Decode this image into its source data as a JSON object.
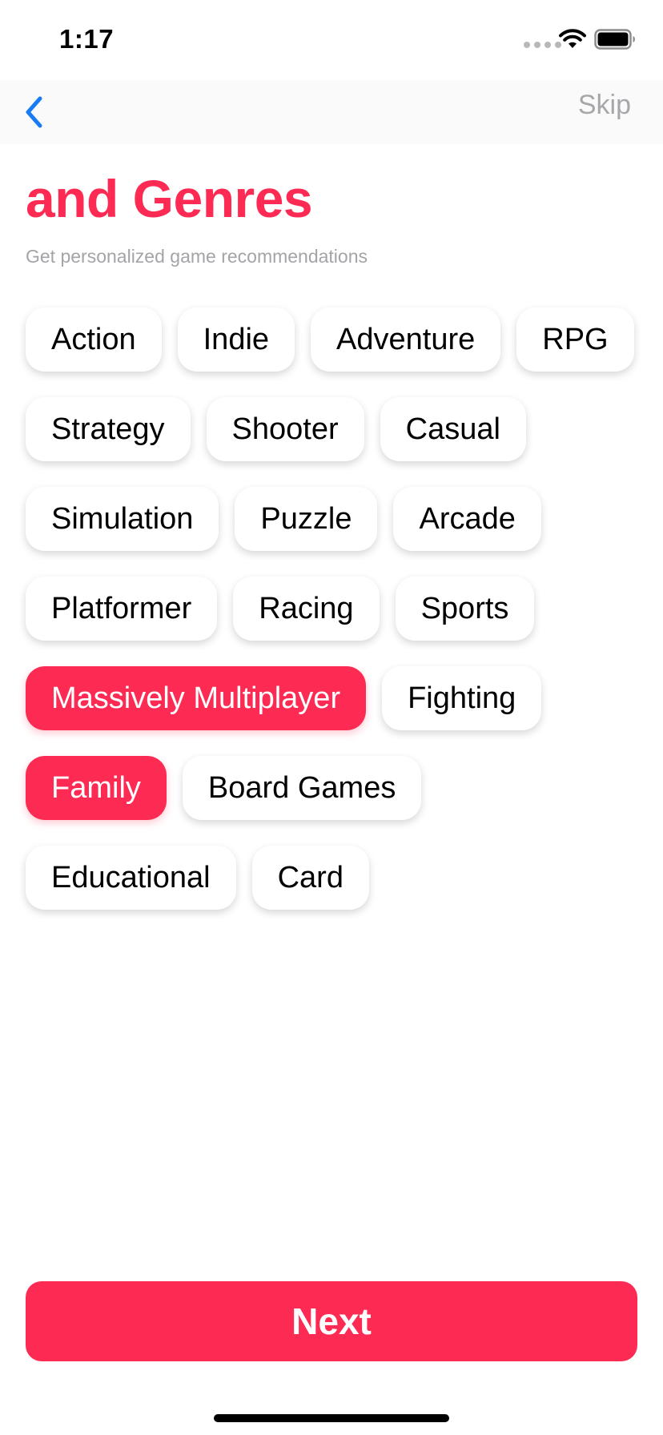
{
  "status_bar": {
    "time": "1:17",
    "icons": [
      "signal-dots-icon",
      "wifi-icon",
      "battery-icon"
    ]
  },
  "nav": {
    "back_icon": "chevron-left-icon",
    "skip_label": "Skip"
  },
  "header": {
    "title": "and Genres",
    "subtitle": "Get personalized game recommendations"
  },
  "genres": [
    {
      "label": "Action",
      "selected": false
    },
    {
      "label": "Indie",
      "selected": false
    },
    {
      "label": "Adventure",
      "selected": false
    },
    {
      "label": "RPG",
      "selected": false
    },
    {
      "label": "Strategy",
      "selected": false
    },
    {
      "label": "Shooter",
      "selected": false
    },
    {
      "label": "Casual",
      "selected": false
    },
    {
      "label": "Simulation",
      "selected": false
    },
    {
      "label": "Puzzle",
      "selected": false
    },
    {
      "label": "Arcade",
      "selected": false
    },
    {
      "label": "Platformer",
      "selected": false
    },
    {
      "label": "Racing",
      "selected": false
    },
    {
      "label": "Sports",
      "selected": false
    },
    {
      "label": "Massively Multiplayer",
      "selected": true
    },
    {
      "label": "Fighting",
      "selected": false
    },
    {
      "label": "Family",
      "selected": true
    },
    {
      "label": "Board Games",
      "selected": false
    },
    {
      "label": "Educational",
      "selected": false
    },
    {
      "label": "Card",
      "selected": false
    }
  ],
  "footer": {
    "next_label": "Next"
  },
  "colors": {
    "accent": "#fd2b53",
    "back_icon": "#1a7cf5",
    "skip_text": "#a7a7ab",
    "subtitle_text": "#a4a4a8"
  }
}
